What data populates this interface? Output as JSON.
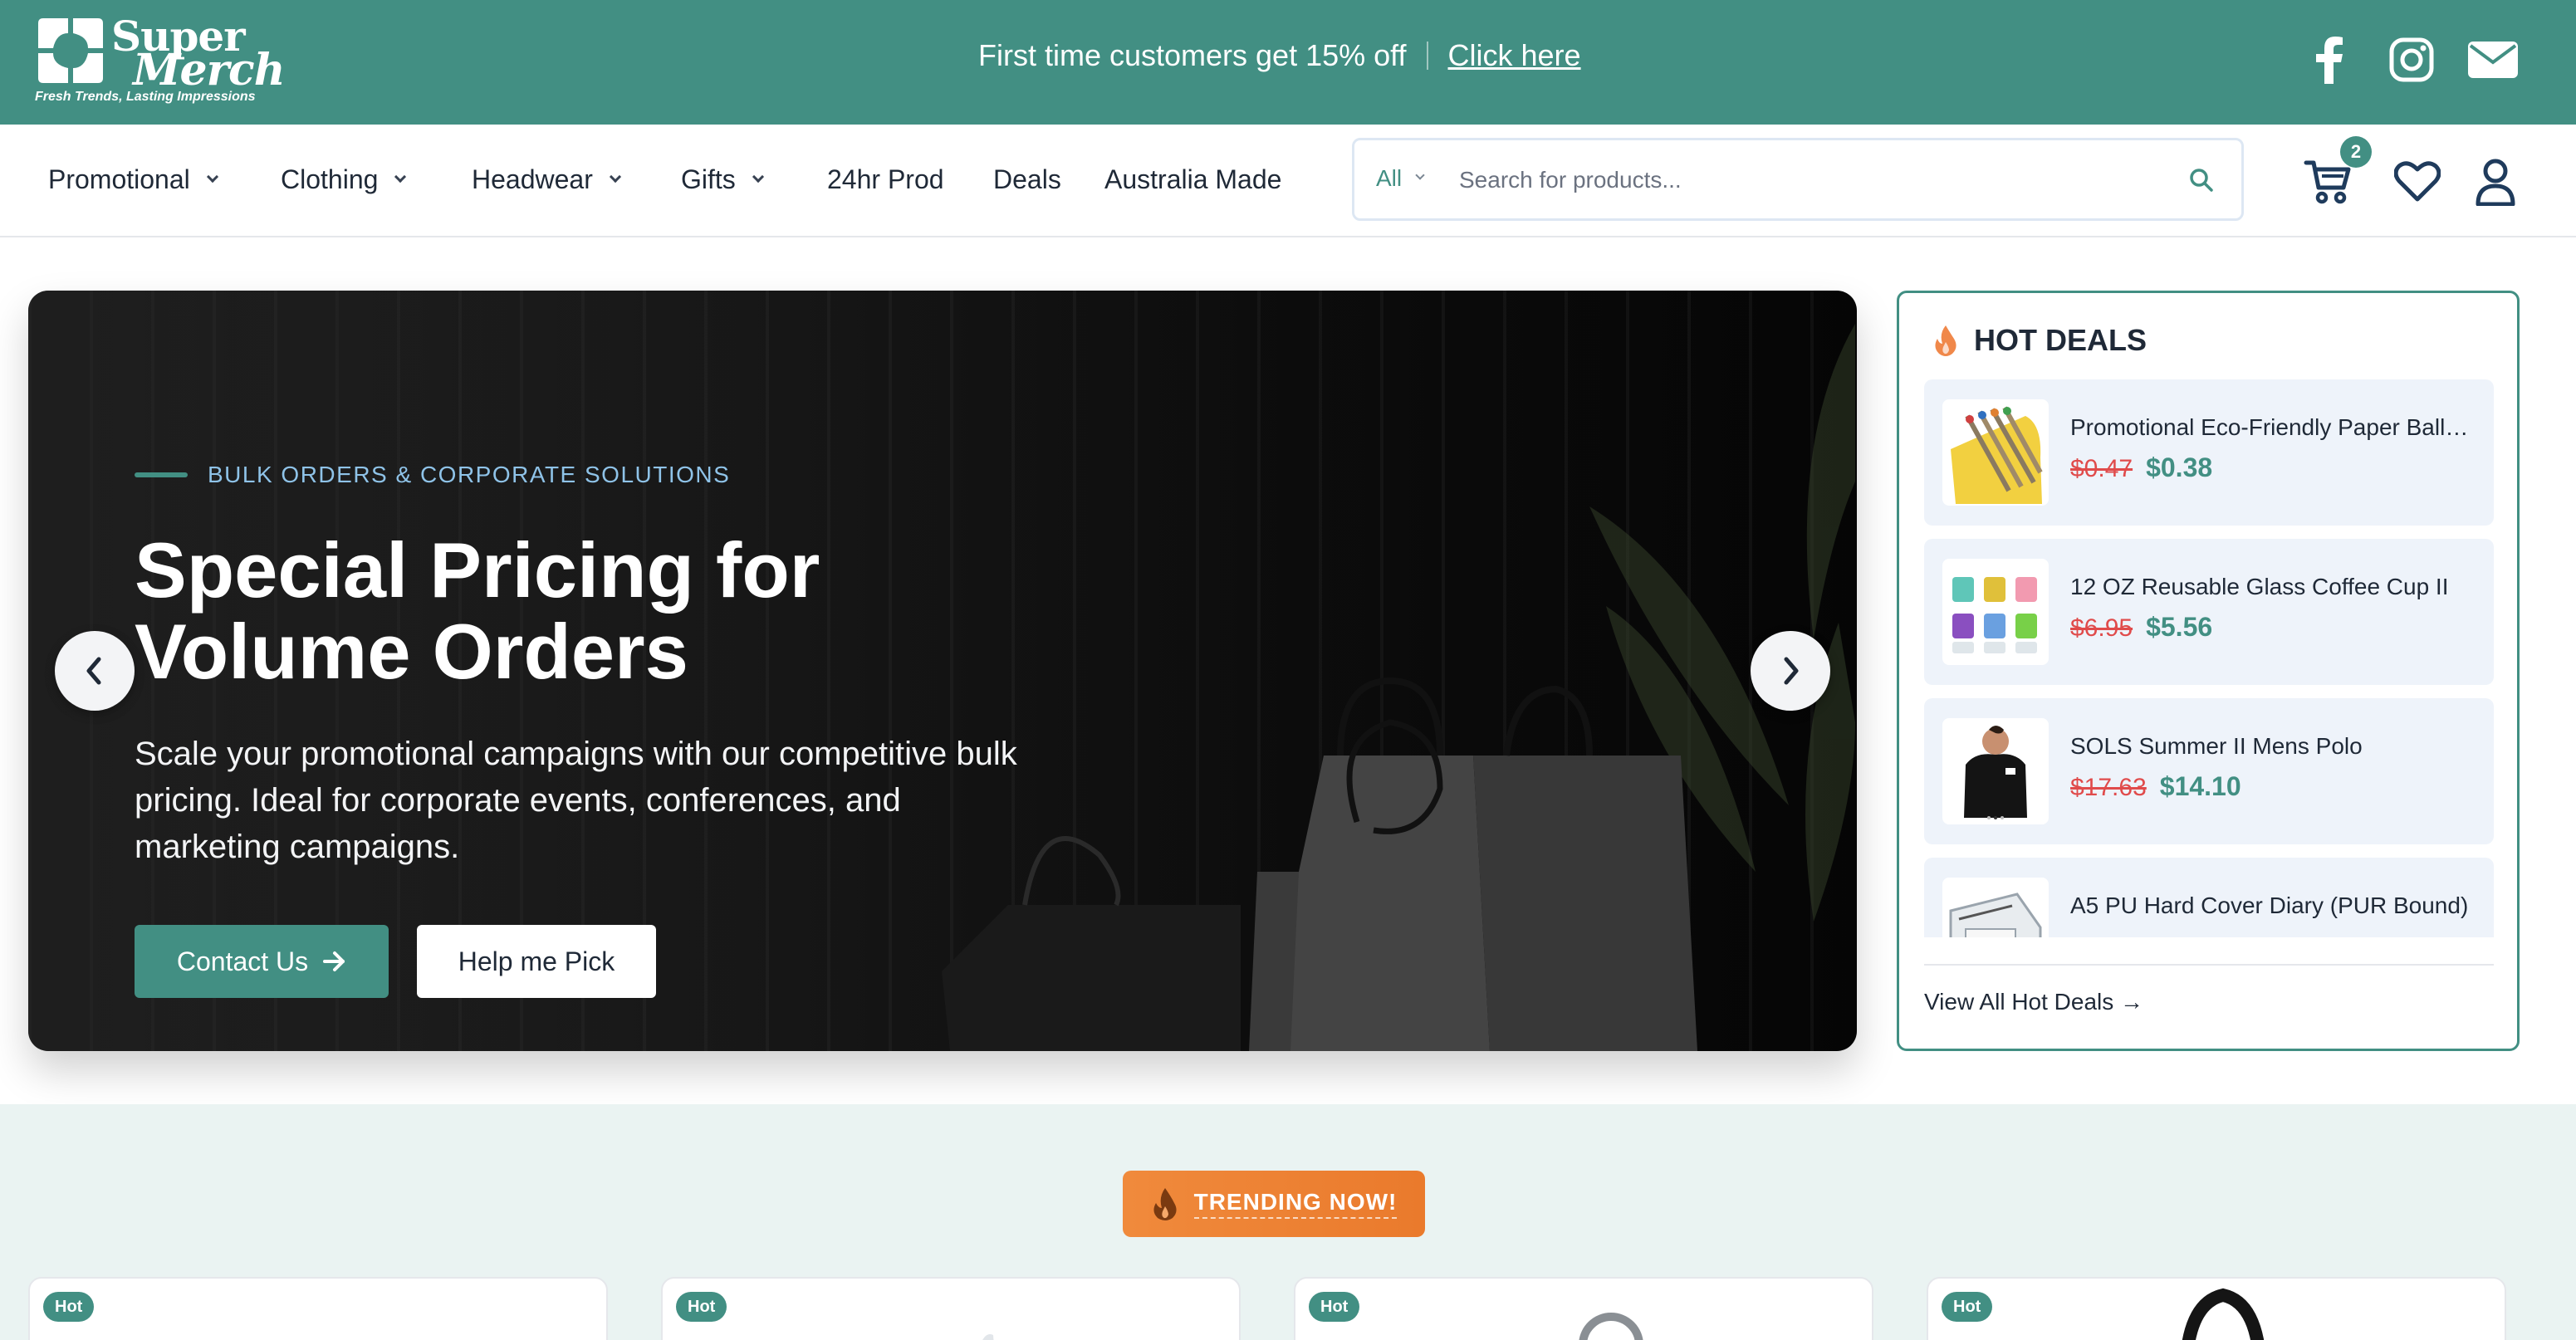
{
  "brand": {
    "name_line1": "Super",
    "name_line2": "Merch",
    "tagline": "Fresh Trends, Lasting Impressions"
  },
  "announcement": {
    "text": "First time customers get 15% off",
    "link": "Click here"
  },
  "social_icons": [
    "facebook-icon",
    "instagram-icon",
    "mail-icon"
  ],
  "nav": {
    "items": [
      {
        "label": "Promotional",
        "dropdown": true
      },
      {
        "label": "Clothing",
        "dropdown": true
      },
      {
        "label": "Headwear",
        "dropdown": true
      },
      {
        "label": "Gifts",
        "dropdown": true
      },
      {
        "label": "24hr Prod",
        "dropdown": false
      },
      {
        "label": "Deals",
        "dropdown": false
      },
      {
        "label": "Australia Made",
        "dropdown": false
      }
    ]
  },
  "search": {
    "category": "All",
    "placeholder": "Search for products..."
  },
  "cart": {
    "count": "2"
  },
  "hero": {
    "eyebrow": "BULK ORDERS & CORPORATE SOLUTIONS",
    "title": "Special Pricing for Volume Orders",
    "description": "Scale your promotional campaigns with our competitive bulk pricing. Ideal for corporate events, conferences, and marketing campaigns.",
    "primary_button": "Contact Us",
    "secondary_button": "Help me Pick"
  },
  "hot_deals": {
    "title": "HOT DEALS",
    "items": [
      {
        "name": "Promotional Eco-Friendly Paper Ballpoint Pen",
        "old_price": "$0.47",
        "new_price": "$0.38"
      },
      {
        "name": "12 OZ Reusable Glass Coffee Cup II",
        "old_price": "$6.95",
        "new_price": "$5.56"
      },
      {
        "name": "SOLS Summer II Mens Polo",
        "old_price": "$17.63",
        "new_price": "$14.10"
      },
      {
        "name": "A5 PU Hard Cover Diary (PUR Bound)",
        "old_price": "",
        "new_price": ""
      }
    ],
    "view_all": "View All Hot Deals →"
  },
  "trending": {
    "badge": "TRENDING NOW!",
    "cards": [
      {
        "tag": "Hot"
      },
      {
        "tag": "Hot"
      },
      {
        "tag": "Hot"
      },
      {
        "tag": "Hot"
      }
    ]
  },
  "colors": {
    "brand_teal": "#428f83",
    "sale_red": "#e04b4b",
    "trending_orange": "#ef8436",
    "eyebrow_blue": "#8fc3e8"
  }
}
